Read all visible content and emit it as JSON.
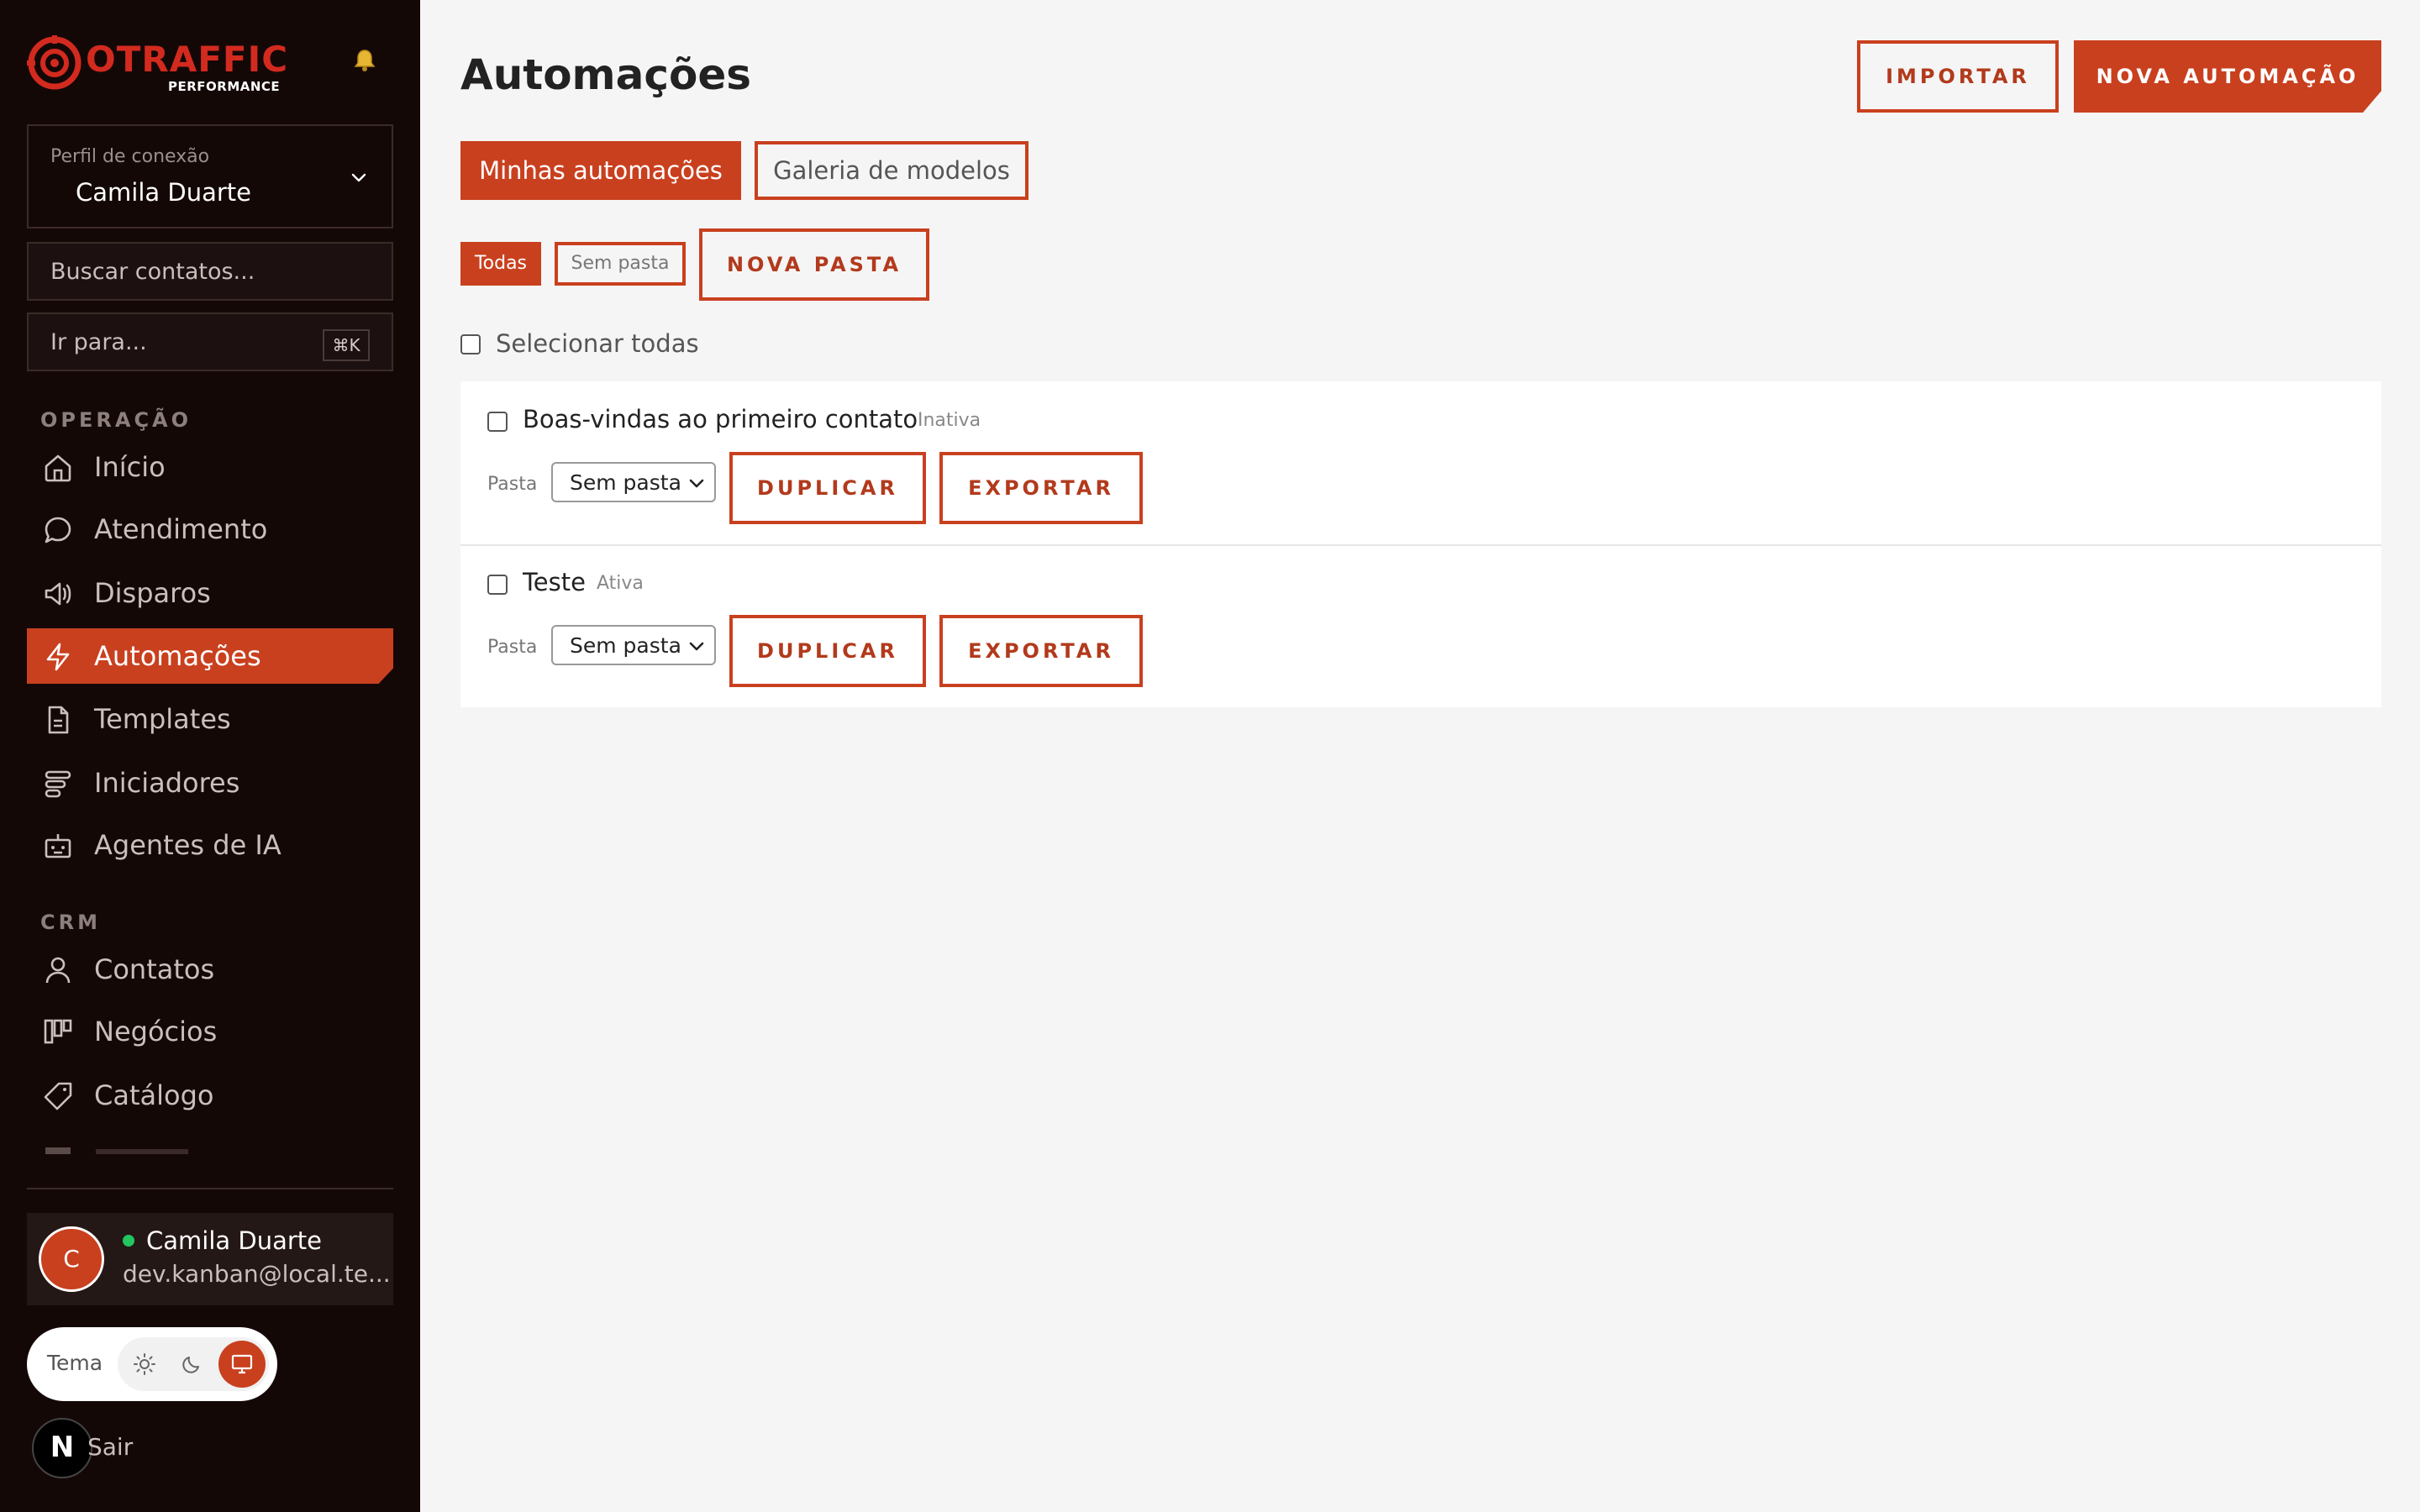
{
  "brand": {
    "name": "OTRAFFIC",
    "subtitle": "PERFORMANCE",
    "accent_color": "#c9401f",
    "logo_color": "#d32a1f"
  },
  "sidebar": {
    "profile": {
      "label": "Perfil de conexão",
      "name": "Camila Duarte"
    },
    "search": {
      "placeholder": "Buscar contatos..."
    },
    "goto": {
      "placeholder": "Ir para...",
      "shortcut": "⌘K"
    },
    "sections": [
      {
        "title": "OPERAÇÃO",
        "items": [
          {
            "label": "Início",
            "icon": "home-icon"
          },
          {
            "label": "Atendimento",
            "icon": "chat-icon"
          },
          {
            "label": "Disparos",
            "icon": "megaphone-icon"
          },
          {
            "label": "Automações",
            "icon": "bolt-icon",
            "active": true
          },
          {
            "label": "Templates",
            "icon": "file-icon"
          },
          {
            "label": "Iniciadores",
            "icon": "stack-icon"
          },
          {
            "label": "Agentes de IA",
            "icon": "bot-icon"
          }
        ]
      },
      {
        "title": "CRM",
        "items": [
          {
            "label": "Contatos",
            "icon": "user-icon"
          },
          {
            "label": "Negócios",
            "icon": "kanban-icon"
          },
          {
            "label": "Catálogo",
            "icon": "tag-icon"
          }
        ]
      }
    ],
    "user": {
      "initial": "C",
      "name": "Camila Duarte",
      "email": "dev.kanban@local.te...",
      "status_color": "#22c55e"
    },
    "theme": {
      "label": "Tema",
      "options": [
        "sun-icon",
        "moon-icon",
        "monitor-icon"
      ],
      "selected": "monitor-icon"
    },
    "dev_badge": "N",
    "logout": "Sair"
  },
  "main": {
    "title": "Automações",
    "import_label": "IMPORTAR",
    "new_automation_label": "NOVA AUTOMAÇÃO",
    "tabs": [
      {
        "label": "Minhas automações",
        "active": true
      },
      {
        "label": "Galeria de modelos",
        "active": false
      }
    ],
    "folders": {
      "all": "Todas",
      "none": "Sem pasta",
      "new_folder": "NOVA PASTA"
    },
    "select_all": "Selecionar todas",
    "automations": [
      {
        "name": "Boas-vindas ao primeiro contato",
        "status": "Inativa",
        "folder_label": "Pasta",
        "folder": "Sem pasta",
        "duplicate": "DUPLICAR",
        "export": "EXPORTAR"
      },
      {
        "name": "Teste",
        "status": "Ativa",
        "folder_label": "Pasta",
        "folder": "Sem pasta",
        "duplicate": "DUPLICAR",
        "export": "EXPORTAR"
      }
    ]
  }
}
